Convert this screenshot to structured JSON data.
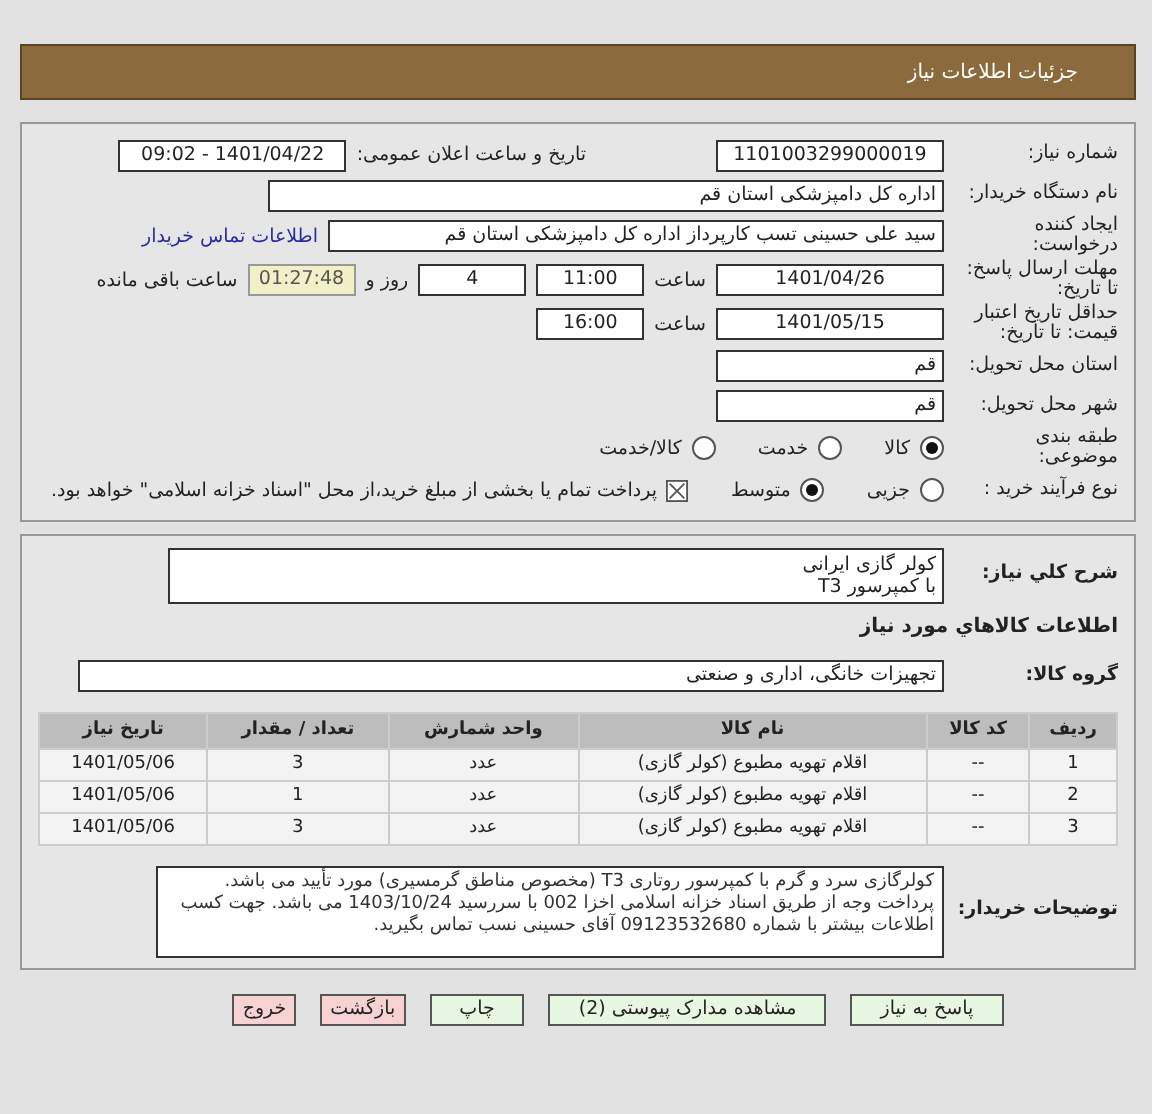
{
  "header": {
    "title": "جزئیات اطلاعات نیاز"
  },
  "need_number": {
    "label": "شماره نیاز:",
    "value": "1101003299000019"
  },
  "announce": {
    "label": "تاریخ و ساعت اعلان عمومی:",
    "value": "1401/04/22 - 09:02"
  },
  "buyer": {
    "label": "نام دستگاه خریدار:",
    "value": "اداره کل دامپزشکی استان قم"
  },
  "creator": {
    "label": "ایجاد کننده درخواست:",
    "value": "سید علی حسینی تسب کارپرداز اداره کل دامپزشکی استان قم",
    "link": "اطلاعات تماس خریدار"
  },
  "deadline": {
    "label": "مهلت ارسال پاسخ: تا تاریخ:",
    "date": "1401/04/26",
    "time_label": "ساعت",
    "time": "11:00",
    "days": "4",
    "days_label": "روز و",
    "remaining": "01:27:48",
    "remaining_label": "ساعت باقی مانده"
  },
  "validity": {
    "label": "حداقل تاریخ اعتبار قیمت: تا تاریخ:",
    "date": "1401/05/15",
    "time_label": "ساعت",
    "time": "16:00"
  },
  "province": {
    "label": "استان محل تحویل:",
    "value": "قم"
  },
  "city": {
    "label": "شهر محل تحویل:",
    "value": "قم"
  },
  "category": {
    "label": "طبقه بندی موضوعی:",
    "options": [
      {
        "label": "کالا",
        "selected": true
      },
      {
        "label": "خدمت",
        "selected": false
      },
      {
        "label": "کالا/خدمت",
        "selected": false
      }
    ]
  },
  "process": {
    "label": "نوع فرآیند خرید :",
    "options": [
      {
        "label": "جزیی",
        "selected": false
      },
      {
        "label": "متوسط",
        "selected": true
      }
    ],
    "payment": {
      "label": "پرداخت تمام یا بخشی از مبلغ خرید،از محل \"اسناد خزانه اسلامی\" خواهد بود.",
      "checked": true
    }
  },
  "description": {
    "label": "شرح کلي نیاز:",
    "lines": [
      "کولر گازی ایرانی",
      "با کمپرسور T3"
    ]
  },
  "goods_heading": "اطلاعات کالاهاي مورد نیاز",
  "goods_group": {
    "label": "گروه کالا:",
    "value": "تجهیزات خانگی، اداری و صنعتی"
  },
  "table": {
    "columns": [
      "ردیف",
      "کد کالا",
      "نام کالا",
      "واحد شمارش",
      "تعداد / مقدار",
      "تاریخ نیاز"
    ],
    "rows": [
      [
        "1",
        "--",
        "اقلام تهویه مطبوع (کولر گازی)",
        "عدد",
        "3",
        "1401/05/06"
      ],
      [
        "2",
        "--",
        "اقلام تهویه مطبوع (کولر گازی)",
        "عدد",
        "1",
        "1401/05/06"
      ],
      [
        "3",
        "--",
        "اقلام تهویه مطبوع (کولر گازی)",
        "عدد",
        "3",
        "1401/05/06"
      ]
    ]
  },
  "buyer_notes": {
    "label": "توضیحات خریدار:",
    "value": "کولرگازی سرد و گرم با کمپرسور روتاری T3 (مخصوص مناطق گرمسیری) مورد تأیید می باشد. پرداخت وجه از طریق اسناد خزانه اسلامی اخزا 002 با سررسید 1403/10/24 می باشد. جهت کسب اطلاعات بیشتر با شماره 09123532680 آقای حسینی نسب تماس بگیرید."
  },
  "buttons": [
    {
      "label": "پاسخ به نیاز",
      "kind": "go"
    },
    {
      "label": "مشاهده مدارک پیوستی (2)",
      "kind": "go"
    },
    {
      "label": "چاپ",
      "kind": "go"
    },
    {
      "label": "بازگشت",
      "kind": "stop"
    },
    {
      "label": "خروج",
      "kind": "stop"
    }
  ]
}
